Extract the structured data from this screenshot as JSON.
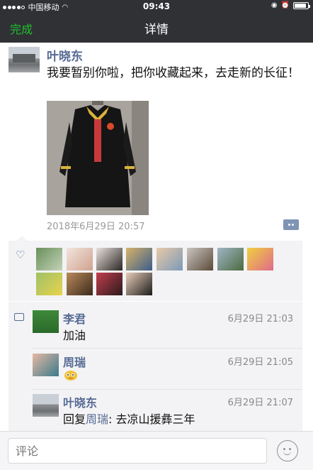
{
  "status_bar": {
    "carrier": "中国移动",
    "time": "09:43",
    "battery_level": 0.9
  },
  "nav": {
    "done_label": "完成",
    "title": "详情"
  },
  "post": {
    "author": "叶晓东",
    "text": "我要暂别你啦，把你收藏起来，去走新的长征！",
    "timestamp": "2018年6月29日 20:57"
  },
  "likes": {
    "count": 12
  },
  "comments": [
    {
      "name": "李君",
      "time": "6月29日 21:03",
      "text": "加油"
    },
    {
      "name": "周瑞",
      "time": "6月29日 21:05",
      "text": ""
    },
    {
      "name": "叶晓东",
      "time": "6月29日 21:07",
      "reply_prefix": "回复",
      "reply_to": "周瑞",
      "reply_text": ": 去凉山援彝三年"
    }
  ],
  "input": {
    "placeholder": "评论"
  },
  "colors": {
    "accent_green": "#1fbf2b",
    "link_blue": "#576b95",
    "nav_bg": "#2f3135"
  },
  "icons": [
    "wifi-icon",
    "lock-rotation-icon",
    "alarm-icon",
    "battery-icon",
    "heart-icon",
    "comment-icon",
    "more-icon",
    "emoji-icon"
  ]
}
